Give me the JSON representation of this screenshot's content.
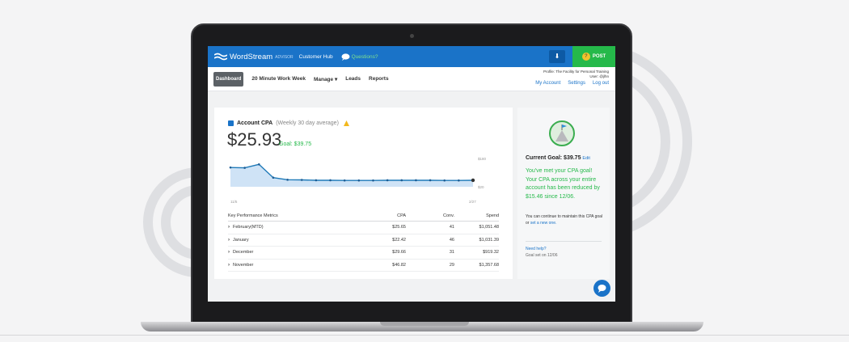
{
  "colors": {
    "brand_blue": "#1a73c8",
    "post_green": "#25b94a",
    "goal_green": "#25b94a"
  },
  "topbar": {
    "brand": "WordStream",
    "brand_sub": "ADVISOR",
    "hub_label": "Customer Hub",
    "questions_label": "Questions?",
    "download_icon": "download-icon",
    "post_label": "POST"
  },
  "nav": {
    "items": [
      "Dashboard",
      "20 Minute Work Week",
      "Manage ▾",
      "Leads",
      "Reports"
    ],
    "profile_line": "Profile: The Facility for Personal Training",
    "user_line": "User: @jlhn",
    "links": [
      "My Account",
      "Settings",
      "Log out"
    ]
  },
  "card": {
    "title": "Account CPA",
    "subtitle": "(Weekly 30 day average)",
    "cpa_value": "$25.93",
    "goal_inline": "Goal: $39.75"
  },
  "chart_data": {
    "type": "line",
    "x_labels": [
      "11/5",
      "2/27"
    ],
    "y_tick_labels": [
      "$180",
      "$20"
    ],
    "ylim": [
      0,
      180
    ],
    "grid": false,
    "values": [
      110,
      108,
      128,
      52,
      40,
      39,
      37,
      37,
      36,
      36,
      36,
      37,
      37,
      37,
      37,
      36,
      36,
      37
    ]
  },
  "kpi": {
    "headers": [
      "Key Performance Metrics",
      "CPA",
      "Conv.",
      "Spend"
    ],
    "rows": [
      {
        "name": "February(MTD)",
        "cpa": "$25.65",
        "conv": "41",
        "spend": "$1,051.48"
      },
      {
        "name": "January",
        "cpa": "$22.42",
        "conv": "46",
        "spend": "$1,031.39"
      },
      {
        "name": "December",
        "cpa": "$29.66",
        "conv": "31",
        "spend": "$919.32"
      },
      {
        "name": "November",
        "cpa": "$46.82",
        "conv": "29",
        "spend": "$1,357.68"
      }
    ]
  },
  "side": {
    "goal_title": "Current Goal: $39.75",
    "edit_label": "Edit",
    "met_text": "You've met your CPA goal! Your CPA across your entire account has been reduced by $15.46 since 12/06.",
    "maintain_text": "You can continue to maintain this CPA goal or",
    "maintain_link": "set a new one.",
    "need_help": "Need help?",
    "goal_set": "Goal set on 12/06"
  }
}
